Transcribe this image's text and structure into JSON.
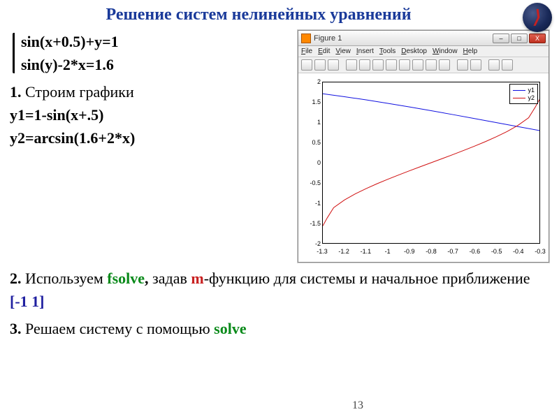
{
  "title": "Решение систем нелинейных уравнений",
  "system": {
    "eq1": "sin(x+0.5)+y=1",
    "eq2": "sin(y)-2*x=1.6"
  },
  "step1": {
    "num": "1.",
    "text": " Строим графики"
  },
  "y1": "y1=1-sin(x+.5)",
  "y2": "y2=arcsin(1.6+2*x)",
  "step2": {
    "num": "2.",
    "text_a": " Используем ",
    "fsolve": "fsolve",
    "comma": ",",
    "text_b": " задав  ",
    "m": "m",
    "text_c": "-функцию для системы и начальное приближение ",
    "approx": "[-1 1]"
  },
  "step3": {
    "num": "3.",
    "text_a": " Решаем систему с помощью ",
    "solve": "solve"
  },
  "page": "13",
  "figure": {
    "title": "Figure 1",
    "menus": [
      "File",
      "Edit",
      "View",
      "Insert",
      "Tools",
      "Desktop",
      "Window",
      "Help"
    ],
    "legend": {
      "s1": "y1",
      "s2": "y2"
    },
    "win_min": "–",
    "win_max": "□",
    "win_close": "X"
  },
  "chart_data": {
    "type": "line",
    "xlabel": "",
    "ylabel": "",
    "xlim": [
      -1.3,
      -0.3
    ],
    "ylim": [
      -2,
      2
    ],
    "xticks": [
      -1.3,
      -1.2,
      -1.1,
      -1,
      -0.9,
      -0.8,
      -0.7,
      -0.6,
      -0.5,
      -0.4,
      -0.3
    ],
    "yticks": [
      -2,
      -1.5,
      -1,
      -0.5,
      0,
      0.5,
      1,
      1.5,
      2
    ],
    "series": [
      {
        "name": "y1",
        "color": "#1010e0",
        "x": [
          -1.3,
          -1.2,
          -1.1,
          -1.0,
          -0.9,
          -0.8,
          -0.7,
          -0.6,
          -0.5,
          -0.4,
          -0.3
        ],
        "y": [
          1.717,
          1.644,
          1.565,
          1.479,
          1.389,
          1.296,
          1.199,
          1.1,
          1.0,
          0.9,
          0.801
        ]
      },
      {
        "name": "y2",
        "color": "#d01010",
        "x": [
          -1.3,
          -1.28,
          -1.25,
          -1.2,
          -1.15,
          -1.1,
          -1.05,
          -1.0,
          -0.95,
          -0.9,
          -0.85,
          -0.8,
          -0.75,
          -0.7,
          -0.65,
          -0.6,
          -0.55,
          -0.5,
          -0.45,
          -0.4,
          -0.35,
          -0.32,
          -0.3
        ],
        "y": [
          -1.571,
          -1.377,
          -1.12,
          -0.927,
          -0.775,
          -0.644,
          -0.524,
          -0.412,
          -0.305,
          -0.201,
          -0.1,
          0.0,
          0.1,
          0.201,
          0.305,
          0.412,
          0.524,
          0.644,
          0.775,
          0.927,
          1.12,
          1.377,
          1.571
        ]
      }
    ]
  }
}
